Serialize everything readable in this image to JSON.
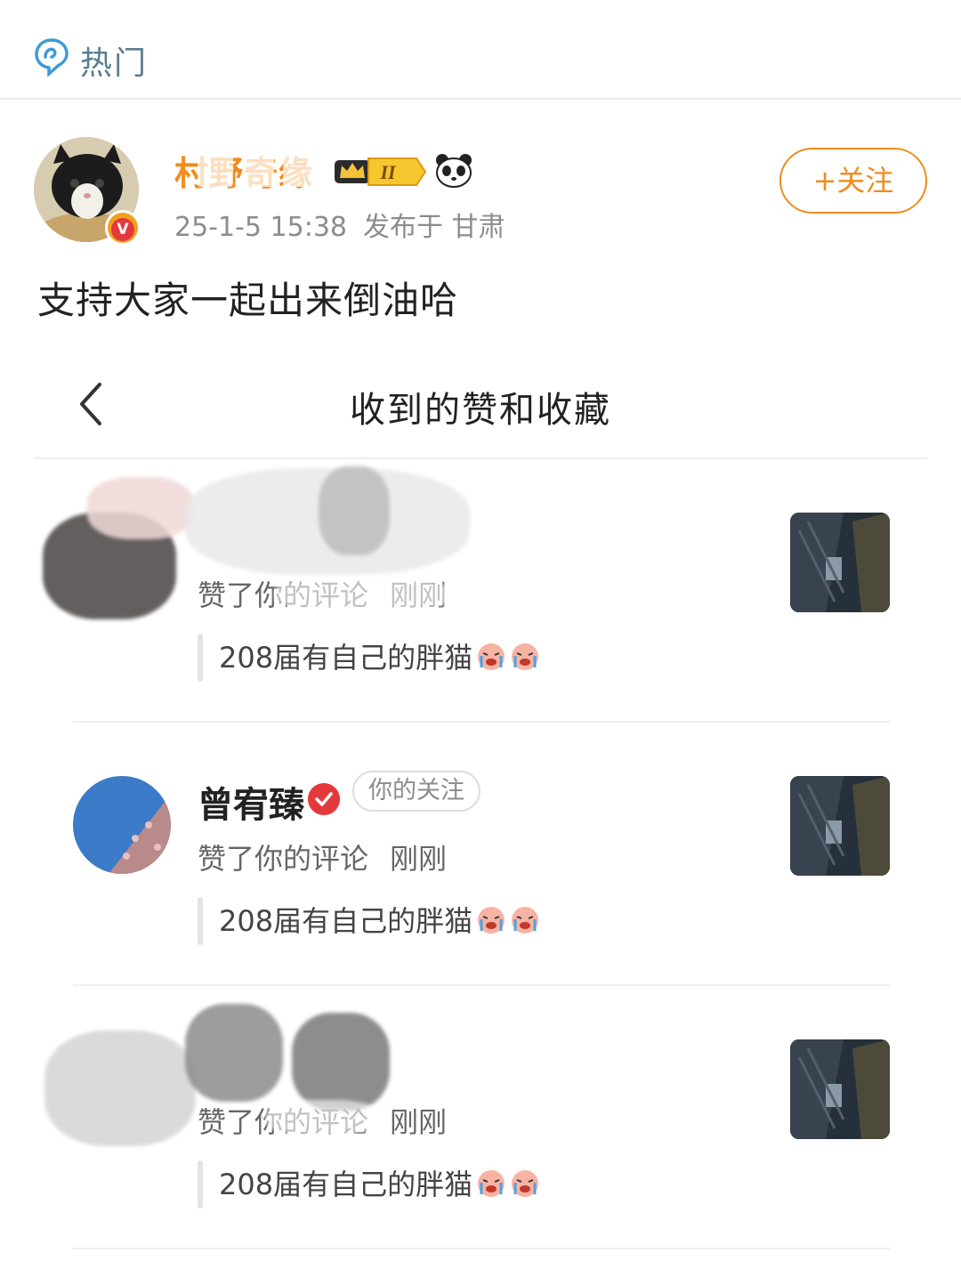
{
  "topbar": {
    "label": "热门",
    "icon": "hot-icon"
  },
  "post": {
    "username": "村野奇缘",
    "verified_badge": "V",
    "timestamp": "25-1-5 15:38",
    "location": "发布于 甘肃",
    "follow_label": "+关注",
    "crown_level": "II",
    "text": "支持大家一起出来倒油哈"
  },
  "embedded": {
    "back_icon": "chevron-left-icon",
    "title": "收到的赞和收藏",
    "items": [
      {
        "name": "",
        "tag": "",
        "action": "赞了你的评论",
        "time": "刚刚",
        "quote": "208届有自己的胖猫"
      },
      {
        "name": "曾宥臻",
        "tag": "你的关注",
        "action": "赞了你的评论",
        "time": "刚刚",
        "quote": "208届有自己的胖猫"
      },
      {
        "name": "",
        "tag": "",
        "action": "赞了你的评论",
        "time": "刚刚",
        "quote": "208届有自己的胖猫"
      }
    ]
  },
  "colors": {
    "accent": "#f08c1e",
    "verified": "#e4393c",
    "muted": "#8c8c8c"
  }
}
